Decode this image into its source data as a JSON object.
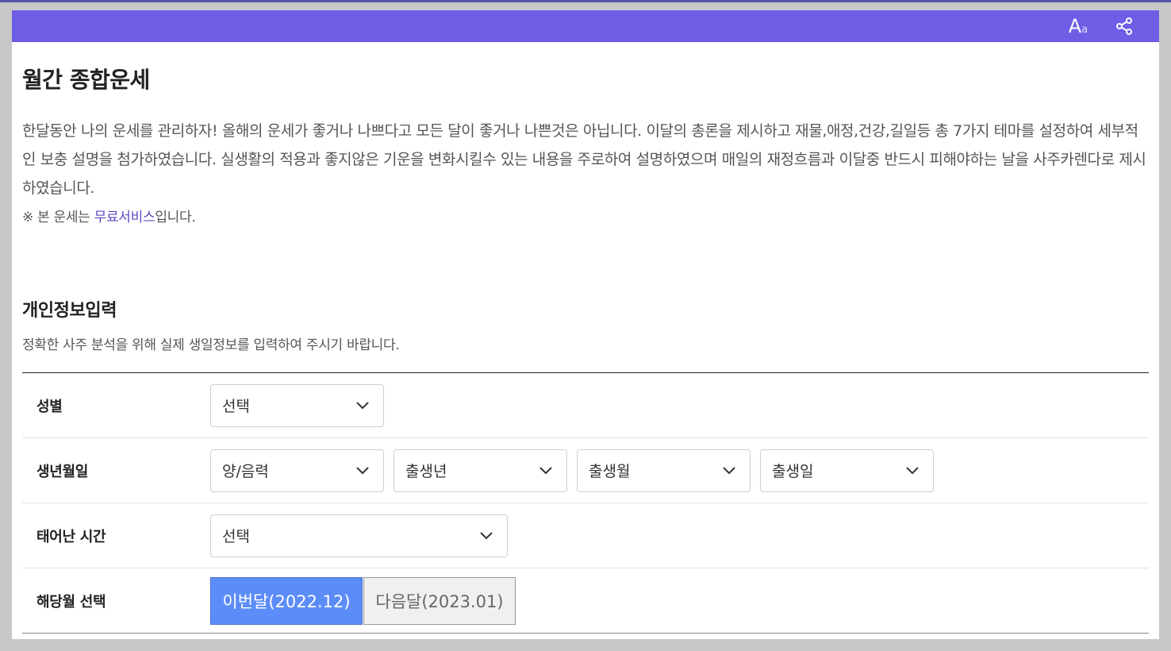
{
  "topbar": {
    "font_size_icon": "font-size-icon",
    "share_icon": "share-icon"
  },
  "page": {
    "title": "월간 종합운세",
    "description": "한달동안 나의 운세를 관리하자! 올해의 운세가 좋거나 나쁘다고 모든 달이 좋거나 나쁜것은 아닙니다. 이달의 총론을 제시하고 재물,애정,건강,길일등 총 7가지 테마를 설정하여 세부적인 보충 설명을 첨가하였습니다. 실생활의 적용과 좋지않은 기운을 변화시킬수 있는 내용을 주로하여 설명하였으며 매일의 재정흐름과 이달중 반드시 피해야하는 날을 사주카렌다로 제시하였습니다.",
    "note_prefix": "※ 본 운세는 ",
    "note_link": "무료서비스",
    "note_suffix": "입니다."
  },
  "section": {
    "title": "개인정보입력",
    "subtitle": "정확한 사주 분석을 위해 실제 생일정보를 입력하여 주시기 바랍니다."
  },
  "form": {
    "gender": {
      "label": "성별",
      "value": "선택"
    },
    "birth": {
      "label": "생년월일",
      "calendar": "양/음력",
      "year": "출생년",
      "month": "출생월",
      "day": "출생일"
    },
    "time": {
      "label": "태어난 시간",
      "value": "선택"
    },
    "month_select": {
      "label": "해당월 선택",
      "this_month": "이번달(2022.12)",
      "next_month": "다음달(2023.01)"
    }
  },
  "colors": {
    "topbar": "#6e5ee6",
    "active_button": "#5c8cf7",
    "link": "#5b4bc4"
  }
}
